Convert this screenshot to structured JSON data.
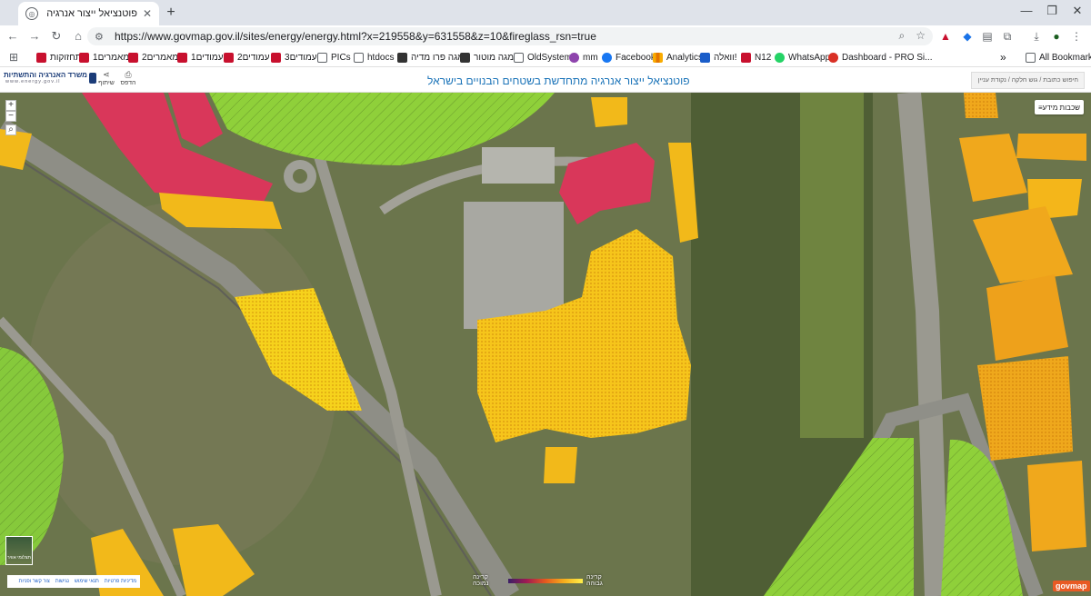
{
  "browser": {
    "tab_title": "פוטנציאל ייצור אנרגיה מתחדשת",
    "tab_close": "✕",
    "new_tab": "+",
    "url": "https://www.govmap.gov.il/sites/energy/energy.html?x=219558&y=631558&z=10&fireglass_rsn=true",
    "window_controls": [
      "—",
      "❐",
      "✕"
    ]
  },
  "bookmarks": {
    "items": [
      {
        "label": "תחזוקות",
        "icon": "red"
      },
      {
        "label": "מאמרים1",
        "icon": "red"
      },
      {
        "label": "מאמרים2",
        "icon": "red"
      },
      {
        "label": "עמודים1",
        "icon": "red"
      },
      {
        "label": "עמודים2",
        "icon": "red"
      },
      {
        "label": "עמודים3",
        "icon": "red"
      },
      {
        "label": "PICs",
        "icon": "folder"
      },
      {
        "label": "htdocs",
        "icon": "folder"
      },
      {
        "label": "מגה פרו מדיה",
        "icon": "dark"
      },
      {
        "label": "מגה מוטור",
        "icon": "dark"
      },
      {
        "label": "OldSystem",
        "icon": "folder"
      },
      {
        "label": "mm",
        "icon": "purple"
      },
      {
        "label": "Facebook",
        "icon": "fb"
      },
      {
        "label": "Analytics",
        "icon": "chart"
      },
      {
        "label": "וואלה!",
        "icon": "blue"
      },
      {
        "label": "N12",
        "icon": "red"
      },
      {
        "label": "WhatsApp",
        "icon": "wa"
      },
      {
        "label": "Dashboard - PRO Si...",
        "icon": "pro"
      }
    ],
    "more": "»",
    "all_bookmarks": "All Bookmarks"
  },
  "site": {
    "ministry_name": "משרד האנרגיה והתשתיות",
    "ministry_sub": "www.energy.gov.il",
    "share_label": "שיתוף",
    "print_label": "הדפס",
    "title": "פוטנציאל ייצור אנרגיה מתחדשת בשטחים הבנויים בישראל",
    "search_placeholder": "חיפוש כתובת / גוש חלקה / נקודת עניין"
  },
  "map": {
    "zoom_in": "+",
    "zoom_out": "−",
    "layers_label": "שכבות מידע",
    "basemap_label": "תצלומי אוויר",
    "footer_links": [
      "מדיניות פרטיות",
      "תנאי שימוש",
      "נגישות",
      "צור קשר ופניות"
    ],
    "legend_low": "קרינה נמוכה",
    "legend_high": "קרינה גבוהה",
    "logo": "govmap"
  }
}
